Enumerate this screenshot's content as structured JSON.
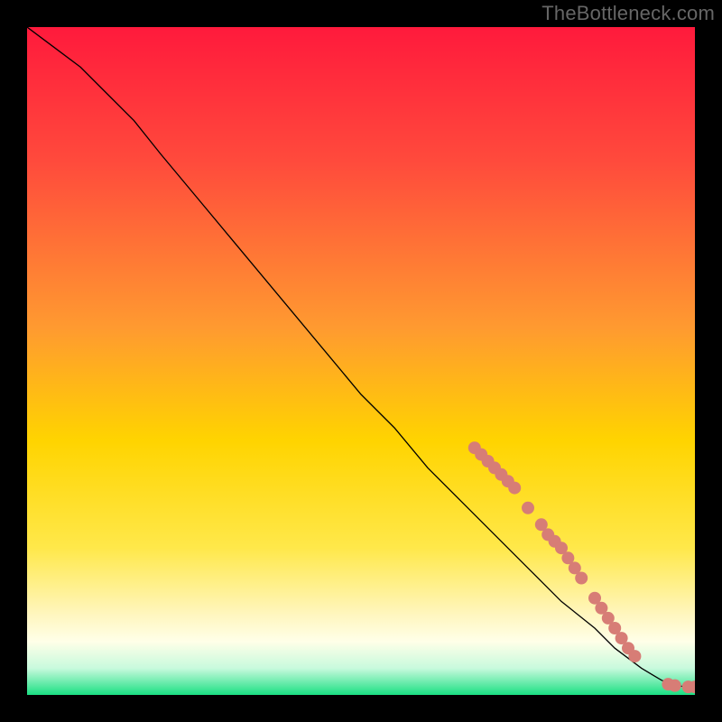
{
  "watermark": "TheBottleneck.com",
  "chart_data": {
    "type": "line",
    "title": "",
    "xlabel": "",
    "ylabel": "",
    "xlim": [
      0,
      100
    ],
    "ylim": [
      0,
      100
    ],
    "grid": false,
    "background_gradient": {
      "stops": [
        {
          "offset": 0,
          "color": "#ff1a3c"
        },
        {
          "offset": 0.2,
          "color": "#ff4a3c"
        },
        {
          "offset": 0.45,
          "color": "#ff9a30"
        },
        {
          "offset": 0.62,
          "color": "#ffd400"
        },
        {
          "offset": 0.78,
          "color": "#ffe84a"
        },
        {
          "offset": 0.88,
          "color": "#fff6bf"
        },
        {
          "offset": 0.92,
          "color": "#ffffe8"
        },
        {
          "offset": 0.96,
          "color": "#c8fadd"
        },
        {
          "offset": 1.0,
          "color": "#1adf82"
        }
      ]
    },
    "series": [
      {
        "name": "curve",
        "color": "#000000",
        "x": [
          0,
          4,
          8,
          12,
          16,
          20,
          25,
          30,
          35,
          40,
          45,
          50,
          55,
          60,
          65,
          70,
          75,
          80,
          85,
          88,
          90,
          92,
          94,
          95,
          96,
          98,
          100
        ],
        "y": [
          100,
          97,
          94,
          90,
          86,
          81,
          75,
          69,
          63,
          57,
          51,
          45,
          40,
          34,
          29,
          24,
          19,
          14,
          10,
          7,
          5.5,
          4,
          2.8,
          2.2,
          1.8,
          1.3,
          1.2
        ]
      }
    ],
    "markers": {
      "name": "highlight-points",
      "color": "#d77d76",
      "radius": 7,
      "points": [
        {
          "x": 67,
          "y": 37
        },
        {
          "x": 68,
          "y": 36
        },
        {
          "x": 69,
          "y": 35
        },
        {
          "x": 70,
          "y": 34
        },
        {
          "x": 71,
          "y": 33
        },
        {
          "x": 72,
          "y": 32
        },
        {
          "x": 73,
          "y": 31
        },
        {
          "x": 75,
          "y": 28
        },
        {
          "x": 77,
          "y": 25.5
        },
        {
          "x": 78,
          "y": 24
        },
        {
          "x": 79,
          "y": 23
        },
        {
          "x": 80,
          "y": 22
        },
        {
          "x": 81,
          "y": 20.5
        },
        {
          "x": 82,
          "y": 19
        },
        {
          "x": 83,
          "y": 17.5
        },
        {
          "x": 85,
          "y": 14.5
        },
        {
          "x": 86,
          "y": 13
        },
        {
          "x": 87,
          "y": 11.5
        },
        {
          "x": 88,
          "y": 10
        },
        {
          "x": 89,
          "y": 8.5
        },
        {
          "x": 90,
          "y": 7
        },
        {
          "x": 91,
          "y": 5.8
        },
        {
          "x": 96,
          "y": 1.6
        },
        {
          "x": 97,
          "y": 1.4
        },
        {
          "x": 99,
          "y": 1.2
        },
        {
          "x": 100,
          "y": 1.2
        }
      ]
    }
  }
}
